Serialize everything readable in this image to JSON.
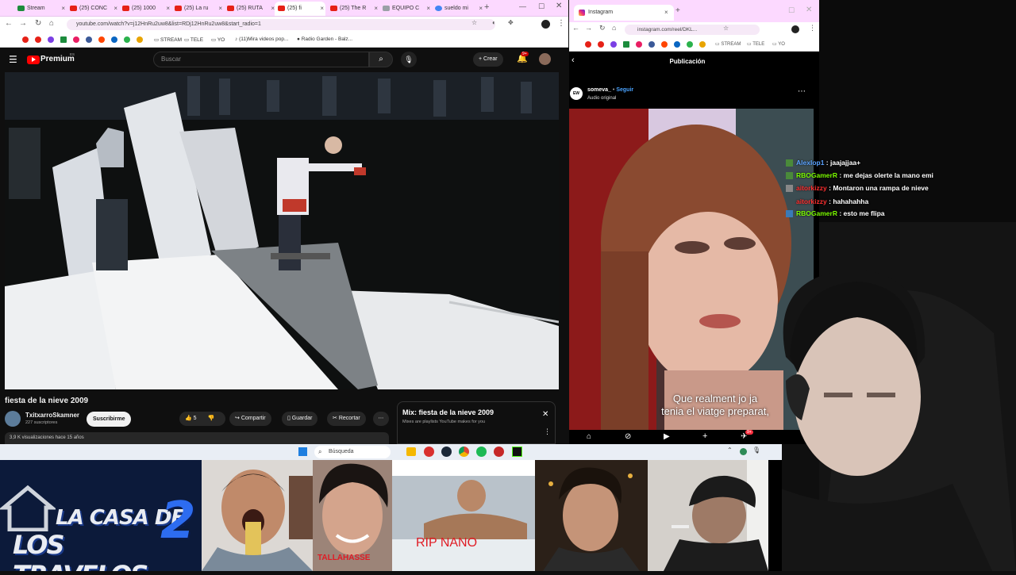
{
  "youtube_browser": {
    "tabs": [
      {
        "label": "Stream"
      },
      {
        "label": "(25) CONC"
      },
      {
        "label": "(25) 1000"
      },
      {
        "label": "(25) La ru"
      },
      {
        "label": "(25) RUTA"
      },
      {
        "label": "(25) fi"
      },
      {
        "label": "(25) The R"
      },
      {
        "label": "EQUIPO C"
      },
      {
        "label": "sueldo mi"
      }
    ],
    "url": "youtube.com/watch?v=j12HnRu2uw8&list=RDj12HnRu2uw8&start_radio=1",
    "bookmarks": [
      "STREAM",
      "TELE",
      "YO",
      "(11)Mira videos pop...",
      "Radio Garden - Balz..."
    ],
    "logo_text": "Premium",
    "logo_badge": "ES",
    "search_placeholder": "Buscar",
    "create_label": "Crear",
    "notif_count": "9+",
    "video_title": "fiesta de la nieve 2009",
    "channel_name": "TxitxarroSkamner",
    "subscribers": "227 suscriptores",
    "subscribe_label": "Suscribirme",
    "likes": "5",
    "share_label": "Compartir",
    "save_label": "Guardar",
    "clip_label": "Recortar",
    "views_line": "3,9 K visualizaciones  hace 15 años",
    "mix_title": "Mix: fiesta de la nieve 2009",
    "mix_sub": "Mixes are playlists YouTube makes for you"
  },
  "instagram_browser": {
    "tab_label": "Instagram",
    "url": "instagram.com/reel/DKL...",
    "bookmarks": [
      "STREAM",
      "TELE",
      "YO"
    ],
    "header_title": "Publicación",
    "username": "someva_",
    "follow_label": "Seguir",
    "audio_label": "Audio original",
    "subtitle_line1": "Que realment jo ja",
    "subtitle_line2": "tenia el viatge preparat,",
    "notif_count": "9+"
  },
  "chat": [
    {
      "user": "Alexlop1",
      "user_color": "#5ba3ff",
      "msg": "jaajajjaa+"
    },
    {
      "user": "RBOGamerR",
      "user_color": "#7cfc00",
      "msg": "me dejas olerte la mano emi"
    },
    {
      "user": "aitorkizzy",
      "user_color": "#ff3030",
      "msg": "Montaron una rampa de nieve"
    },
    {
      "user": "aitorkizzy",
      "user_color": "#ff3030",
      "msg": "hahahahha"
    },
    {
      "user": "RBOGamerR",
      "user_color": "#7cfc00",
      "msg": "esto me flipa"
    }
  ],
  "taskbar": {
    "search_label": "Búsqueda"
  },
  "thumbnails": {
    "logo_line1": "LA CASA DE",
    "logo_line2": "LOS TRAVELOS",
    "logo_num": "2",
    "caption_1": "TALLAHASSE",
    "caption_2": "RIP NANO"
  }
}
